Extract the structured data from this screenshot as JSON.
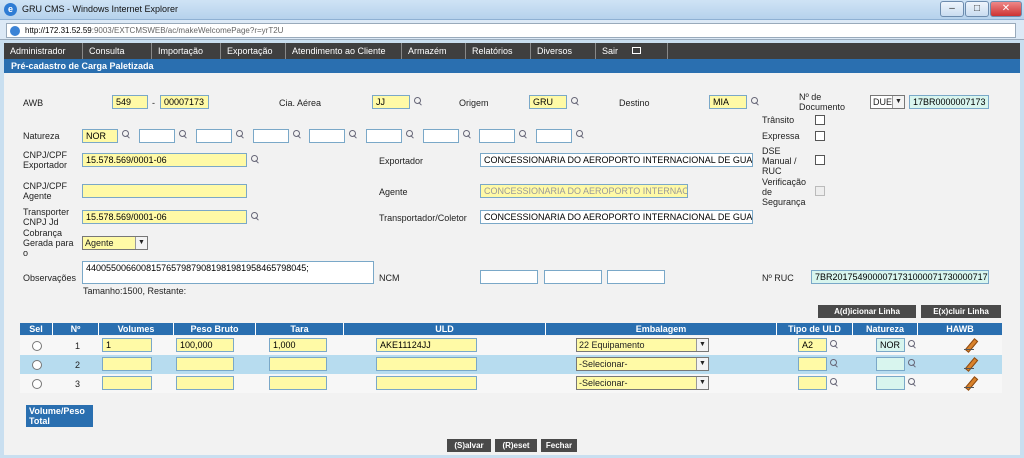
{
  "window": {
    "title": "GRU CMS - Windows Internet Explorer",
    "controls": {
      "minimize": "–",
      "maximize": "□",
      "close": "✕"
    }
  },
  "address": {
    "host": "http://172.31.52.59",
    "path": ":9003/EXTCMSWEB/ac/makeWelcomePage?r=yrT2U"
  },
  "nav": {
    "items": [
      "Administrador",
      "Consulta",
      "Importação",
      "Exportação",
      "Atendimento ao Cliente",
      "Armazém",
      "Relatórios",
      "Diversos",
      "Sair"
    ]
  },
  "section": {
    "title": "Pré-cadastro de Carga Paletizada"
  },
  "form": {
    "awb": {
      "label": "AWB",
      "prefix": "549",
      "separator": "-",
      "number": "00007173"
    },
    "cia": {
      "label": "Cia. Aérea",
      "value": "JJ"
    },
    "origem": {
      "label": "Origem",
      "value": "GRU"
    },
    "destino": {
      "label": "Destino",
      "value": "MIA"
    },
    "documento": {
      "label": "Nº de Documento",
      "type": "DUE",
      "value": "17BR0000007173"
    },
    "natureza": {
      "label": "Natureza",
      "values": [
        "NOR",
        "",
        "",
        "",
        "",
        "",
        "",
        "",
        ""
      ]
    },
    "checks": {
      "transito": "Trânsito",
      "expressa": "Expressa",
      "dse": "DSE Manual / RUC",
      "verificacao": "Verificação de Segurança"
    },
    "cnpj_exportador": {
      "label": "CNPJ/CPF Exportador",
      "value": "15.578.569/0001-06"
    },
    "exportador": {
      "label": "Exportador",
      "value": "CONCESSIONARIA DO AEROPORTO INTERNACIONAL DE GUARULHOS"
    },
    "cnpj_agente": {
      "label": "CNPJ/CPF Agente",
      "value": ""
    },
    "agente": {
      "label": "Agente",
      "value": "CONCESSIONARIA DO AEROPORTO INTERNACIONAL"
    },
    "cnpj_transportador": {
      "label": "Transporter CNPJ Jd",
      "value": "15.578.569/0001-06"
    },
    "transportador": {
      "label": "Transportador/Coletor",
      "value": "CONCESSIONARIA DO AEROPORTO INTERNACIONAL DE GUARULHOS"
    },
    "cobranca": {
      "label": "Cobrança Gerada para o",
      "value": "Agente"
    },
    "observacoes": {
      "label": "Observações",
      "value": "44005500660081576579879081981981958465798045;",
      "counter": "Tamanho:1500, Restante:"
    },
    "ncm": {
      "label": "NCM",
      "values": [
        "",
        "",
        ""
      ]
    },
    "ruc": {
      "label": "Nº RUC",
      "value": "7BR20175490000717310000717300007173"
    }
  },
  "actions": {
    "add_line": "A(d)icionar Linha",
    "remove_line": "E(x)cluir Linha"
  },
  "table": {
    "headers": [
      "Sel",
      "Nº",
      "Volumes",
      "Peso Bruto",
      "Tara",
      "ULD",
      "Embalagem",
      "Tipo de ULD",
      "Natureza",
      "HAWB"
    ],
    "rows": [
      {
        "n": "1",
        "volumes": "1",
        "peso": "100,000",
        "tara": "1,000",
        "uld": "AKE11124JJ",
        "embalagem": "22 Equipamento",
        "tipo": "A2",
        "natureza": "NOR"
      },
      {
        "n": "2",
        "volumes": "",
        "peso": "",
        "tara": "",
        "uld": "",
        "embalagem": "-Selecionar-",
        "tipo": "",
        "natureza": ""
      },
      {
        "n": "3",
        "volumes": "",
        "peso": "",
        "tara": "",
        "uld": "",
        "embalagem": "-Selecionar-",
        "tipo": "",
        "natureza": ""
      }
    ]
  },
  "total": {
    "label": "Volume/Peso Total"
  },
  "footer": {
    "save": "(S)alvar",
    "reset": "(R)eset",
    "close": "Fechar"
  }
}
